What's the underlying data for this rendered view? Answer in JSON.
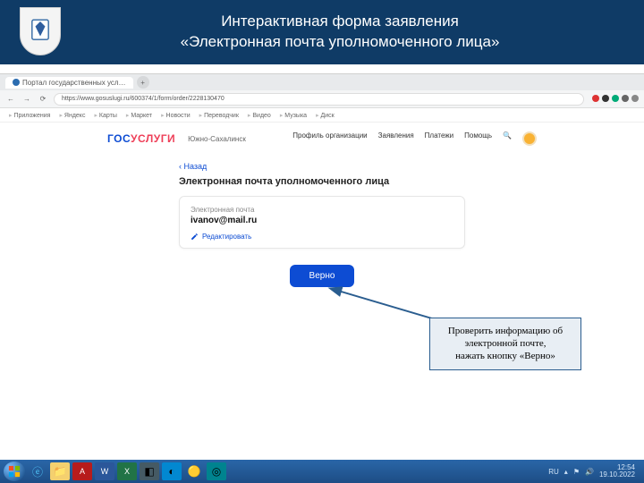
{
  "slide": {
    "title_line1": "Интерактивная форма заявления",
    "title_line2": "«Электронная почта уполномоченного лица»"
  },
  "browser": {
    "tab_title": "Портал государственных усл…",
    "url": "https://www.gosuslugi.ru/600374/1/form/order/2228130470",
    "bookmarks": [
      "Приложения",
      "Яндекс",
      "Карты",
      "Маркет",
      "Новости",
      "Переводчик",
      "Видео",
      "Музыка",
      "Диск"
    ]
  },
  "site": {
    "logo_gos": "ГОС",
    "logo_uslugi": "УСЛУГИ",
    "city": "Южно-Сахалинск",
    "nav": [
      "Профиль организации",
      "Заявления",
      "Платежи",
      "Помощь"
    ]
  },
  "form": {
    "back": "Назад",
    "heading": "Электронная почта уполномоченного лица",
    "field_label": "Электронная почта",
    "field_value": "ivanov@mail.ru",
    "edit": "Редактировать",
    "confirm": "Верно"
  },
  "callout": {
    "line1": "Проверить информацию об",
    "line2": "электронной почте,",
    "line3": "нажать кнопку «Верно»"
  },
  "taskbar": {
    "lang": "RU",
    "time": "12:54",
    "date": "19.10.2022"
  }
}
